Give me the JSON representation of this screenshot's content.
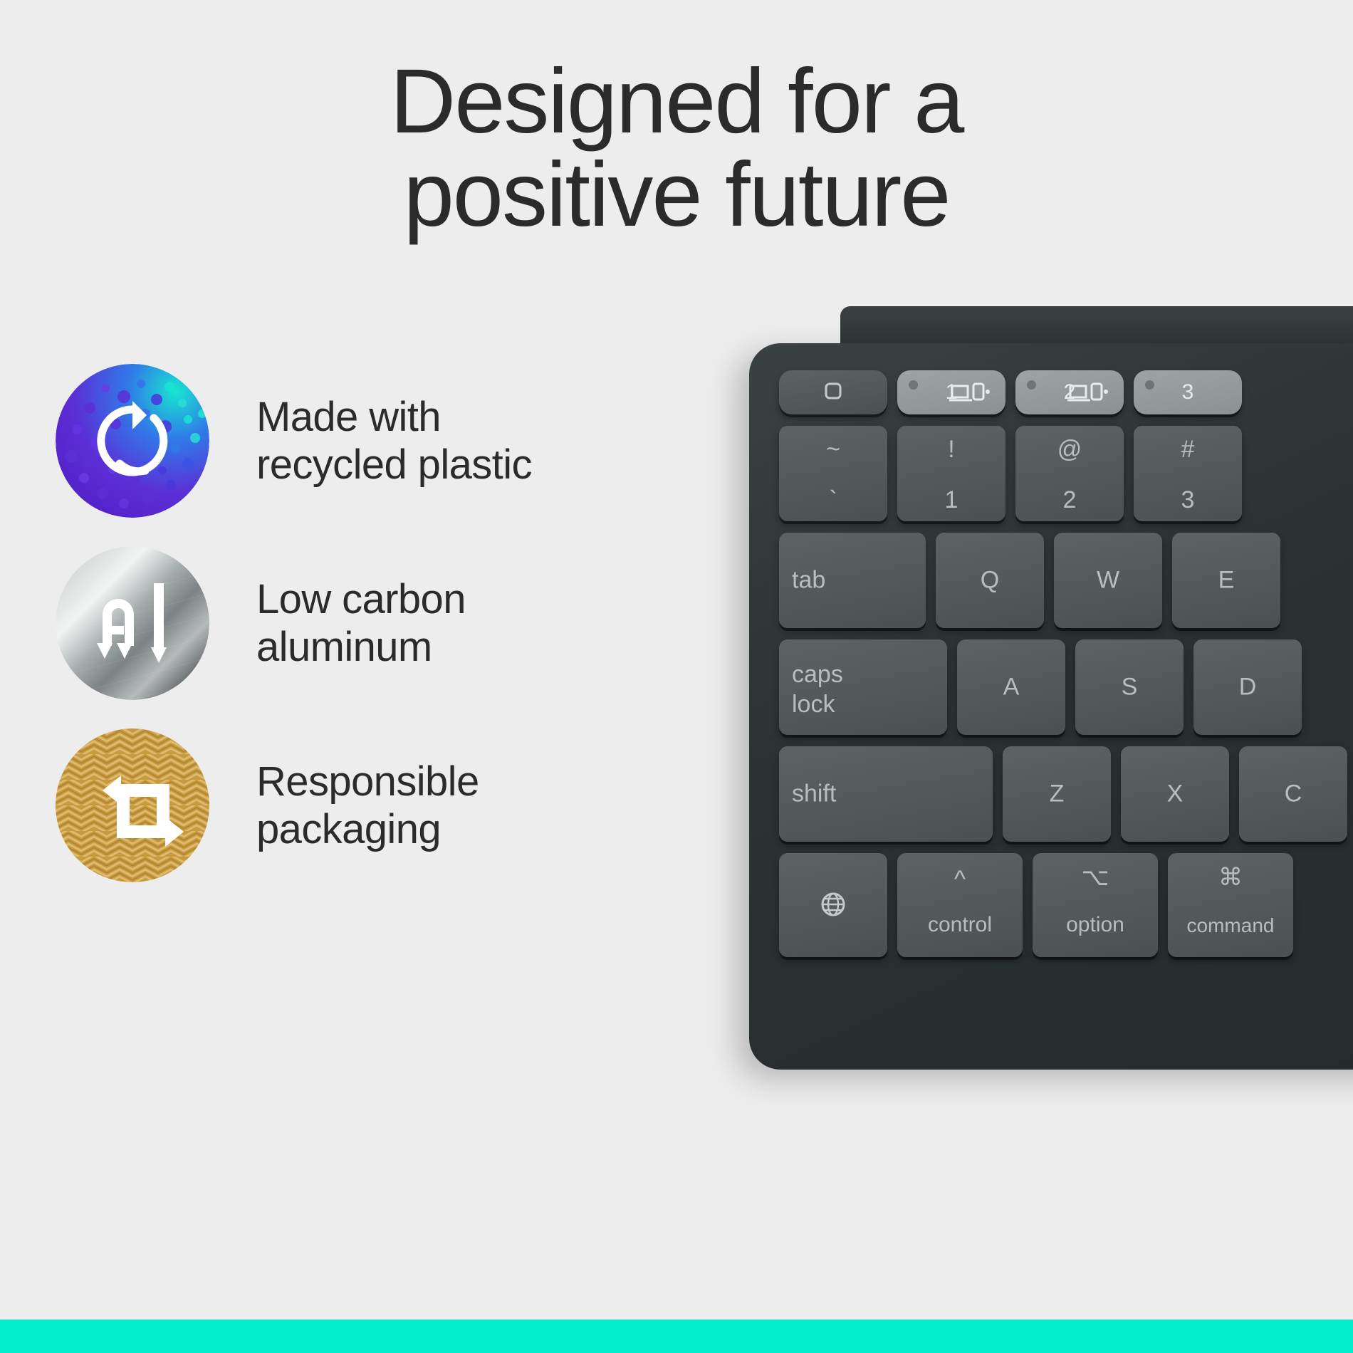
{
  "page": {
    "background_color": "#ededed",
    "accent_bar_color": "#00efcb",
    "text_color": "#2b2b2b"
  },
  "headline": {
    "line1": "Designed for a",
    "line2": "positive future"
  },
  "features": [
    {
      "icon_name": "recycled-plastic-icon",
      "icon_colors": {
        "base": "#5b2fd6",
        "mid": "#3b52e8",
        "accent": "#18e6d0"
      },
      "label_line1": "Made with",
      "label_line2": "recycled plastic"
    },
    {
      "icon_name": "low-carbon-aluminum-icon",
      "icon_colors": {
        "base": "#b8bcbd",
        "mid": "#e8eaea",
        "accent": "#4b4f51"
      },
      "icon_text": "Al",
      "label_line1": "Low carbon",
      "label_line2": "aluminum"
    },
    {
      "icon_name": "responsible-packaging-icon",
      "icon_colors": {
        "base": "#c79a3e",
        "mid": "#e0bd72",
        "accent": "#a87f2c"
      },
      "label_line1": "Responsible",
      "label_line2": "packaging"
    }
  ],
  "keyboard": {
    "body_color": "#2c3234",
    "key_color": "#53595b",
    "key_light_color": "#93989a",
    "legend_color": "#b9bdbe",
    "function_row": [
      {
        "name": "esc-key",
        "icon": "rounded-square-icon",
        "style": "dark"
      },
      {
        "name": "channel-1-key",
        "label": "1",
        "icon": "device-switch-icon",
        "style": "light",
        "has_led": true
      },
      {
        "name": "channel-2-key",
        "label": "2",
        "icon": "device-switch-icon",
        "style": "light",
        "has_led": true
      },
      {
        "name": "channel-3-key",
        "label": "3",
        "icon": "device-switch-icon",
        "style": "light",
        "has_led": true
      }
    ],
    "number_row": [
      {
        "name": "backtick-key",
        "top": "~",
        "bottom": "`"
      },
      {
        "name": "one-key",
        "top": "!",
        "bottom": "1"
      },
      {
        "name": "two-key",
        "top": "@",
        "bottom": "2"
      },
      {
        "name": "three-key",
        "top": "#",
        "bottom": "3"
      }
    ],
    "tab_row": [
      {
        "name": "tab-key",
        "label": "tab",
        "align": "left",
        "width": "wide"
      },
      {
        "name": "q-key",
        "label": "Q"
      },
      {
        "name": "w-key",
        "label": "W"
      },
      {
        "name": "e-key",
        "label": "E"
      }
    ],
    "home_row": [
      {
        "name": "caps-lock-key",
        "label_line1": "caps",
        "label_line2": "lock",
        "align": "left",
        "width": "wide"
      },
      {
        "name": "a-key",
        "label": "A"
      },
      {
        "name": "s-key",
        "label": "S"
      },
      {
        "name": "d-key",
        "label": "D"
      }
    ],
    "shift_row": [
      {
        "name": "shift-key",
        "label": "shift",
        "align": "left",
        "width": "wide"
      },
      {
        "name": "z-key",
        "label": "Z"
      },
      {
        "name": "x-key",
        "label": "X"
      },
      {
        "name": "c-key",
        "label": "C"
      }
    ],
    "bottom_row": [
      {
        "name": "globe-key",
        "icon": "globe-icon"
      },
      {
        "name": "control-key",
        "label": "control",
        "symbol": "^"
      },
      {
        "name": "option-key",
        "label": "option",
        "symbol": "⌥"
      },
      {
        "name": "command-key",
        "label": "command",
        "symbol": "⌘"
      }
    ]
  }
}
